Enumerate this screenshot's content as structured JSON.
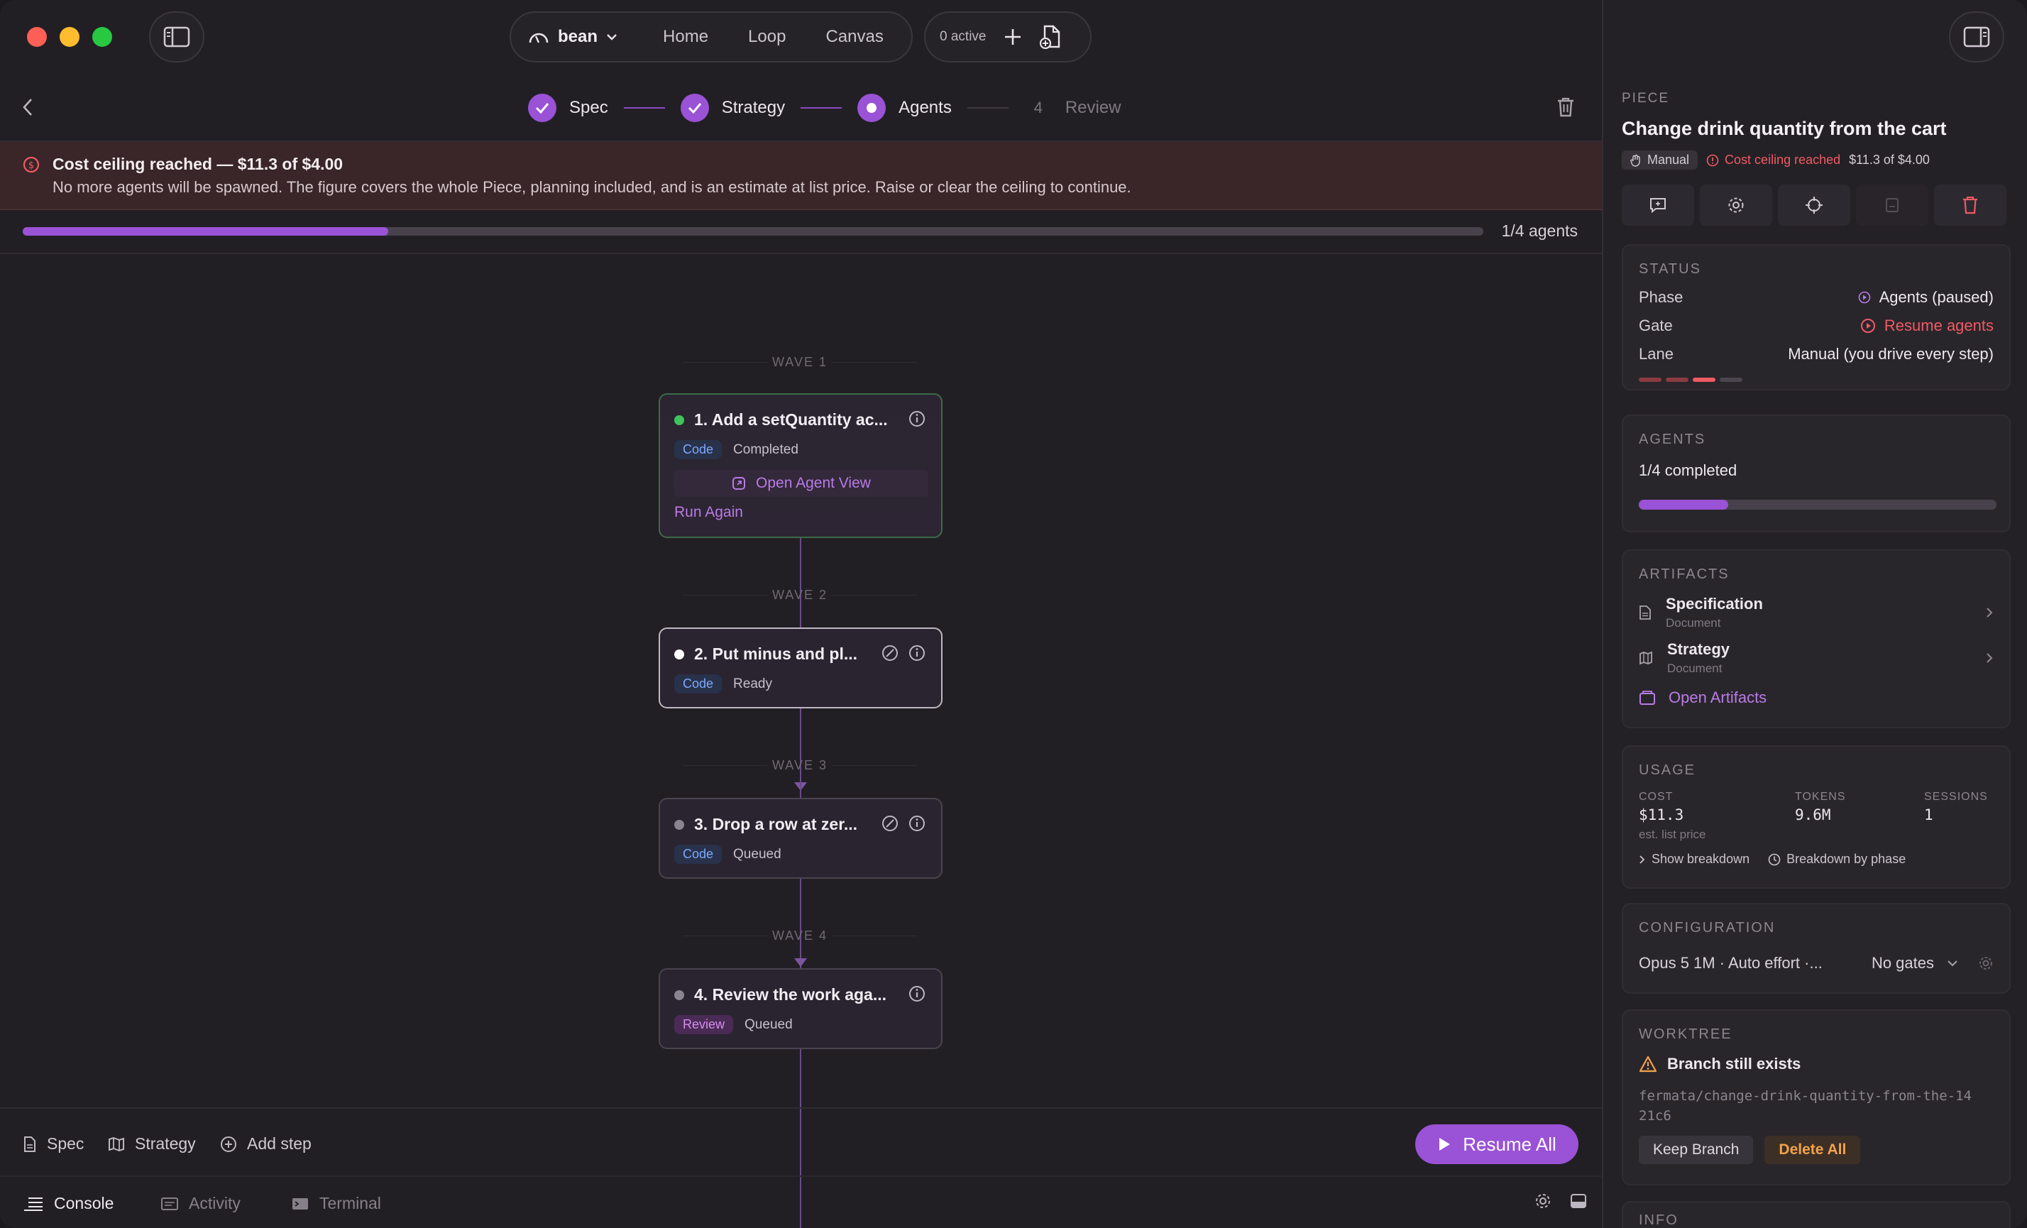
{
  "titlebar": {
    "project": "bean",
    "nav": [
      "Home",
      "Loop",
      "Canvas"
    ],
    "active_count": "0 active"
  },
  "stepper": {
    "steps": [
      {
        "label": "Spec",
        "state": "done"
      },
      {
        "label": "Strategy",
        "state": "done"
      },
      {
        "label": "Agents",
        "state": "current"
      },
      {
        "label": "Review",
        "state": "pending",
        "number": "4"
      }
    ]
  },
  "alert": {
    "title": "Cost ceiling reached — $11.3 of $4.00",
    "message": "No more agents will be spawned. The figure covers the whole Piece, planning included, and is an estimate at list price. Raise or clear the ceiling to continue."
  },
  "progress": {
    "label": "1/4 agents",
    "fraction": 0.25
  },
  "waves": [
    "WAVE 1",
    "WAVE 2",
    "WAVE 3",
    "WAVE 4"
  ],
  "cards": [
    {
      "title": "1. Add a setQuantity ac...",
      "badge": "Code",
      "status": "Completed",
      "dot": "#3fc45a",
      "open_view": "Open Agent View",
      "run_again": "Run Again"
    },
    {
      "title": "2. Put minus and pl...",
      "badge": "Code",
      "status": "Ready",
      "dot": "#ffffff"
    },
    {
      "title": "3. Drop a row at zer...",
      "badge": "Code",
      "status": "Queued",
      "dot": "#8a848e"
    },
    {
      "title": "4. Review the work aga...",
      "badge": "Review",
      "status": "Queued",
      "dot": "#8a848e"
    }
  ],
  "bottombar": {
    "spec": "Spec",
    "strategy": "Strategy",
    "add_step": "Add step",
    "resume": "Resume All"
  },
  "statusbar": {
    "console": "Console",
    "activity": "Activity",
    "terminal": "Terminal"
  },
  "panel": {
    "kicker": "PIECE",
    "title": "Change drink quantity from the cart",
    "tag_manual": "Manual",
    "tag_cost": "Cost ceiling reached",
    "tag_amount": "$11.3 of $4.00",
    "status": {
      "header": "STATUS",
      "phase_k": "Phase",
      "phase_v": "Agents (paused)",
      "gate_k": "Gate",
      "gate_v": "Resume agents",
      "lane_k": "Lane",
      "lane_v": "Manual (you drive every step)"
    },
    "agents": {
      "header": "AGENTS",
      "summary": "1/4 completed",
      "fraction": 0.25
    },
    "artifacts": {
      "header": "ARTIFACTS",
      "items": [
        {
          "name": "Specification",
          "type": "Document"
        },
        {
          "name": "Strategy",
          "type": "Document"
        }
      ],
      "open": "Open Artifacts"
    },
    "usage": {
      "header": "USAGE",
      "cost_label": "COST",
      "cost": "$11.3",
      "cost_note": "est. list price",
      "tokens_label": "TOKENS",
      "tokens": "9.6M",
      "sessions_label": "SESSIONS",
      "sessions": "1",
      "show_breakdown": "Show breakdown",
      "by_phase": "Breakdown by phase"
    },
    "config": {
      "header": "CONFIGURATION",
      "model": "Opus 5 1M · Auto effort ·...",
      "gates": "No gates"
    },
    "worktree": {
      "header": "WORKTREE",
      "warning": "Branch still exists",
      "path": "fermata/change-drink-quantity-from-the-1421c6",
      "keep": "Keep Branch",
      "delete": "Delete All"
    },
    "info_header": "INFO"
  },
  "colors": {
    "accent": "#9a52d6",
    "danger": "#f05a63",
    "success": "#3fc45a",
    "warning": "#f3a24b"
  }
}
